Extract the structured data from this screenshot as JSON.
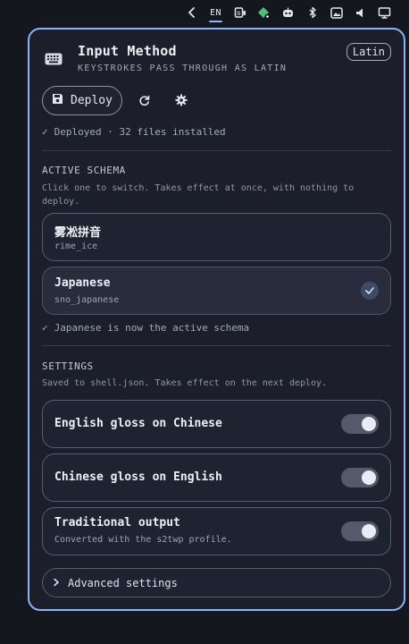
{
  "tray": {
    "lang": "EN",
    "icons": [
      "chevron-left-icon",
      "keyboard-badge-icon",
      "sync-diamond-icon",
      "robot-icon",
      "bluetooth-icon",
      "image-icon",
      "volume-icon",
      "monitor-icon"
    ]
  },
  "header": {
    "title": "Input Method",
    "subtitle": "KEYSTROKES PASS THROUGH AS LATIN",
    "mode_badge": "Latin"
  },
  "toolbar": {
    "deploy_label": "Deploy"
  },
  "status": {
    "deploy_status": "Deployed · 32 files installed"
  },
  "schema": {
    "title": "ACTIVE SCHEMA",
    "description": "Click one to switch. Takes effect at once, with nothing to deploy.",
    "items": [
      {
        "name": "雾凇拼音",
        "id": "rime_ice",
        "selected": false
      },
      {
        "name": "Japanese",
        "id": "sno_japanese",
        "selected": true
      }
    ],
    "note": "Japanese is now the active schema"
  },
  "settings": {
    "title": "SETTINGS",
    "description": "Saved to shell.json. Takes effect on the next deploy.",
    "items": [
      {
        "label": "English gloss on Chinese",
        "sub": "",
        "on": true
      },
      {
        "label": "Chinese gloss on English",
        "sub": "",
        "on": true
      },
      {
        "label": "Traditional output",
        "sub": "Converted with the s2twp profile.",
        "on": true
      }
    ],
    "advanced_label": "Advanced settings"
  },
  "colors": {
    "accent": "#8db4f6",
    "panel_bg": "#1c1f2b",
    "page_bg": "#15171f"
  }
}
